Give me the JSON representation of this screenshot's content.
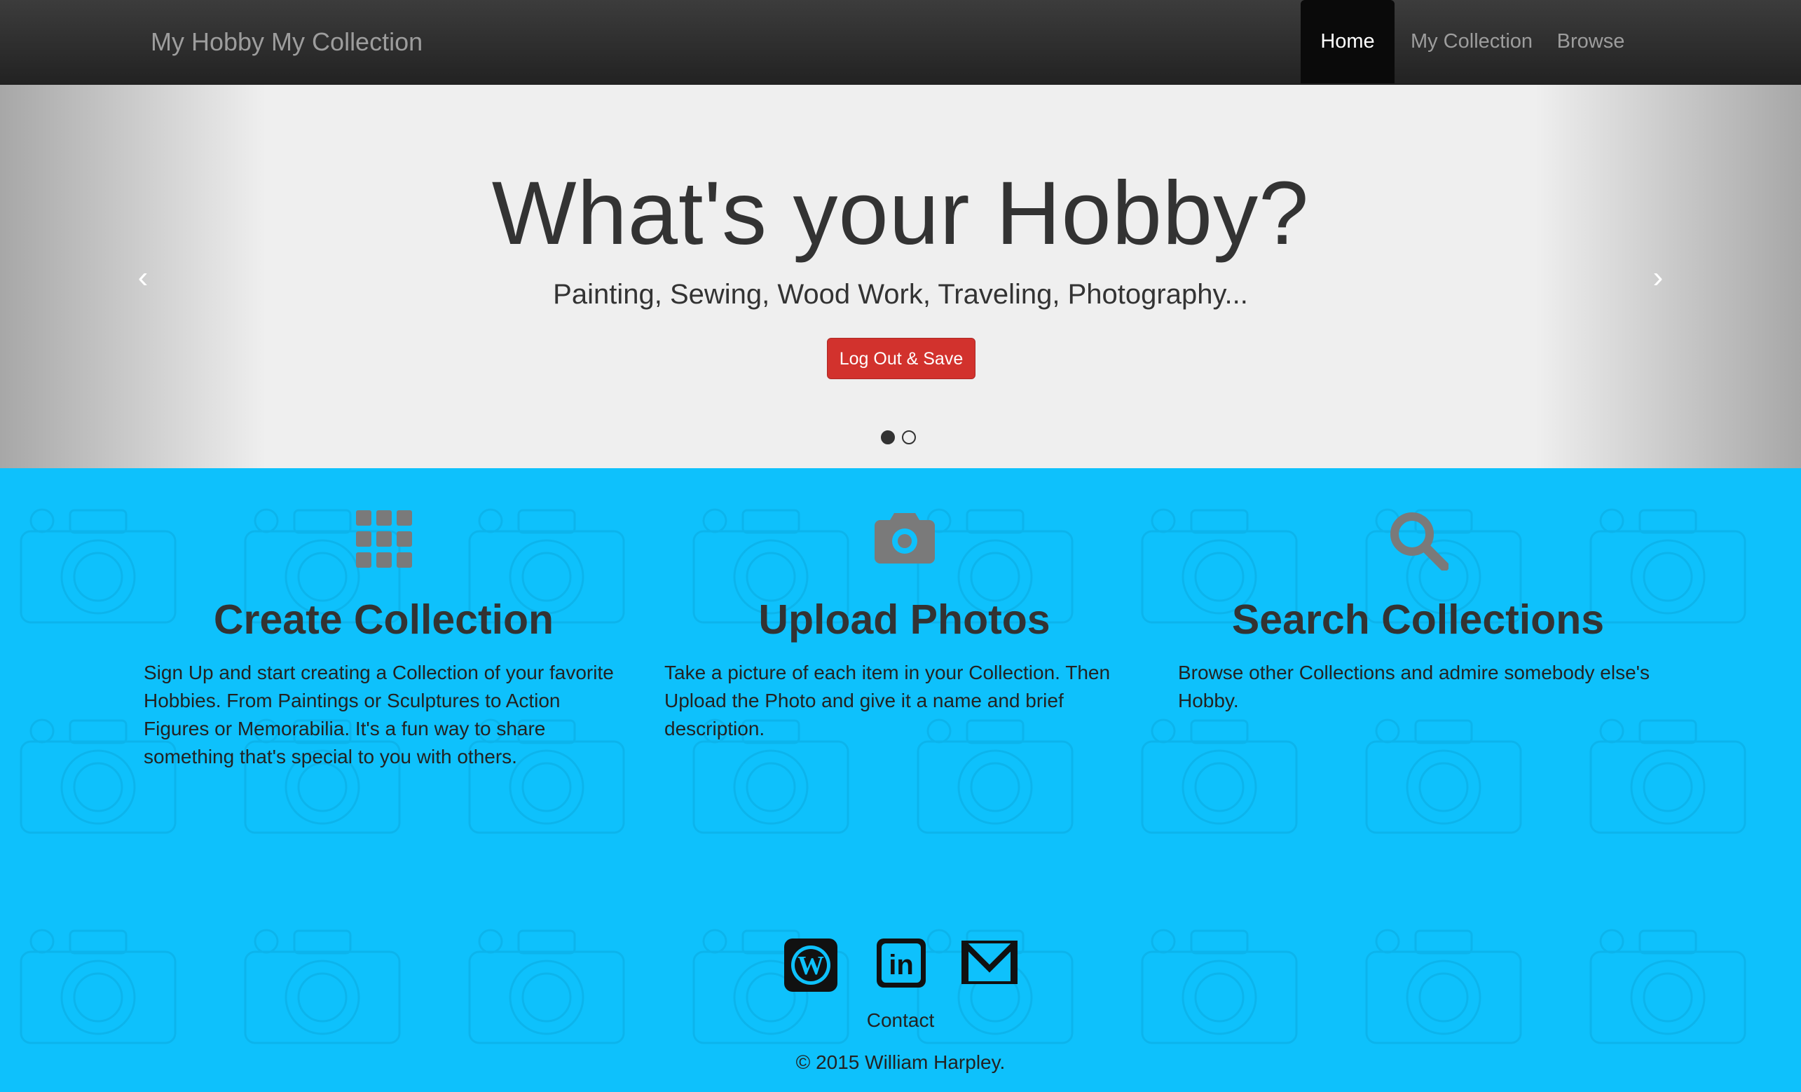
{
  "navbar": {
    "brand": "My Hobby My Collection",
    "items": [
      {
        "label": "Home",
        "active": true
      },
      {
        "label": "My Collection",
        "active": false
      },
      {
        "label": "Browse",
        "active": false
      }
    ]
  },
  "carousel": {
    "title": "What's your Hobby?",
    "subtitle": "Painting, Sewing, Wood Work, Traveling, Photography...",
    "button_label": "Log Out & Save",
    "prev_icon": "chevron-left-icon",
    "next_icon": "chevron-right-icon",
    "slide_count": 2,
    "active_slide": 1
  },
  "features": [
    {
      "icon": "grid-icon",
      "title": "Create Collection",
      "text": "Sign Up and start creating a Collection of your favorite Hobbies. From Paintings or Sculptures to Action Figures or Memorabilia. It's a fun way to share something that's special to you with others."
    },
    {
      "icon": "camera-icon",
      "title": "Upload Photos",
      "text": "Take a picture of each item in your Collection. Then Upload the Photo and give it a name and brief description."
    },
    {
      "icon": "search-icon",
      "title": "Search Collections",
      "text": "Browse other Collections and admire somebody else's Hobby."
    }
  ],
  "footer": {
    "social_icons": [
      "wordpress-icon",
      "linkedin-icon",
      "gmail-icon"
    ],
    "contact": "Contact",
    "copyright": "© 2015 William Harpley."
  },
  "colors": {
    "navbar": "#222222",
    "hero_background": "#efefef",
    "button": "#d2322d",
    "features_background": "#0ec1fc",
    "icon_gray": "#7a7a7a"
  }
}
